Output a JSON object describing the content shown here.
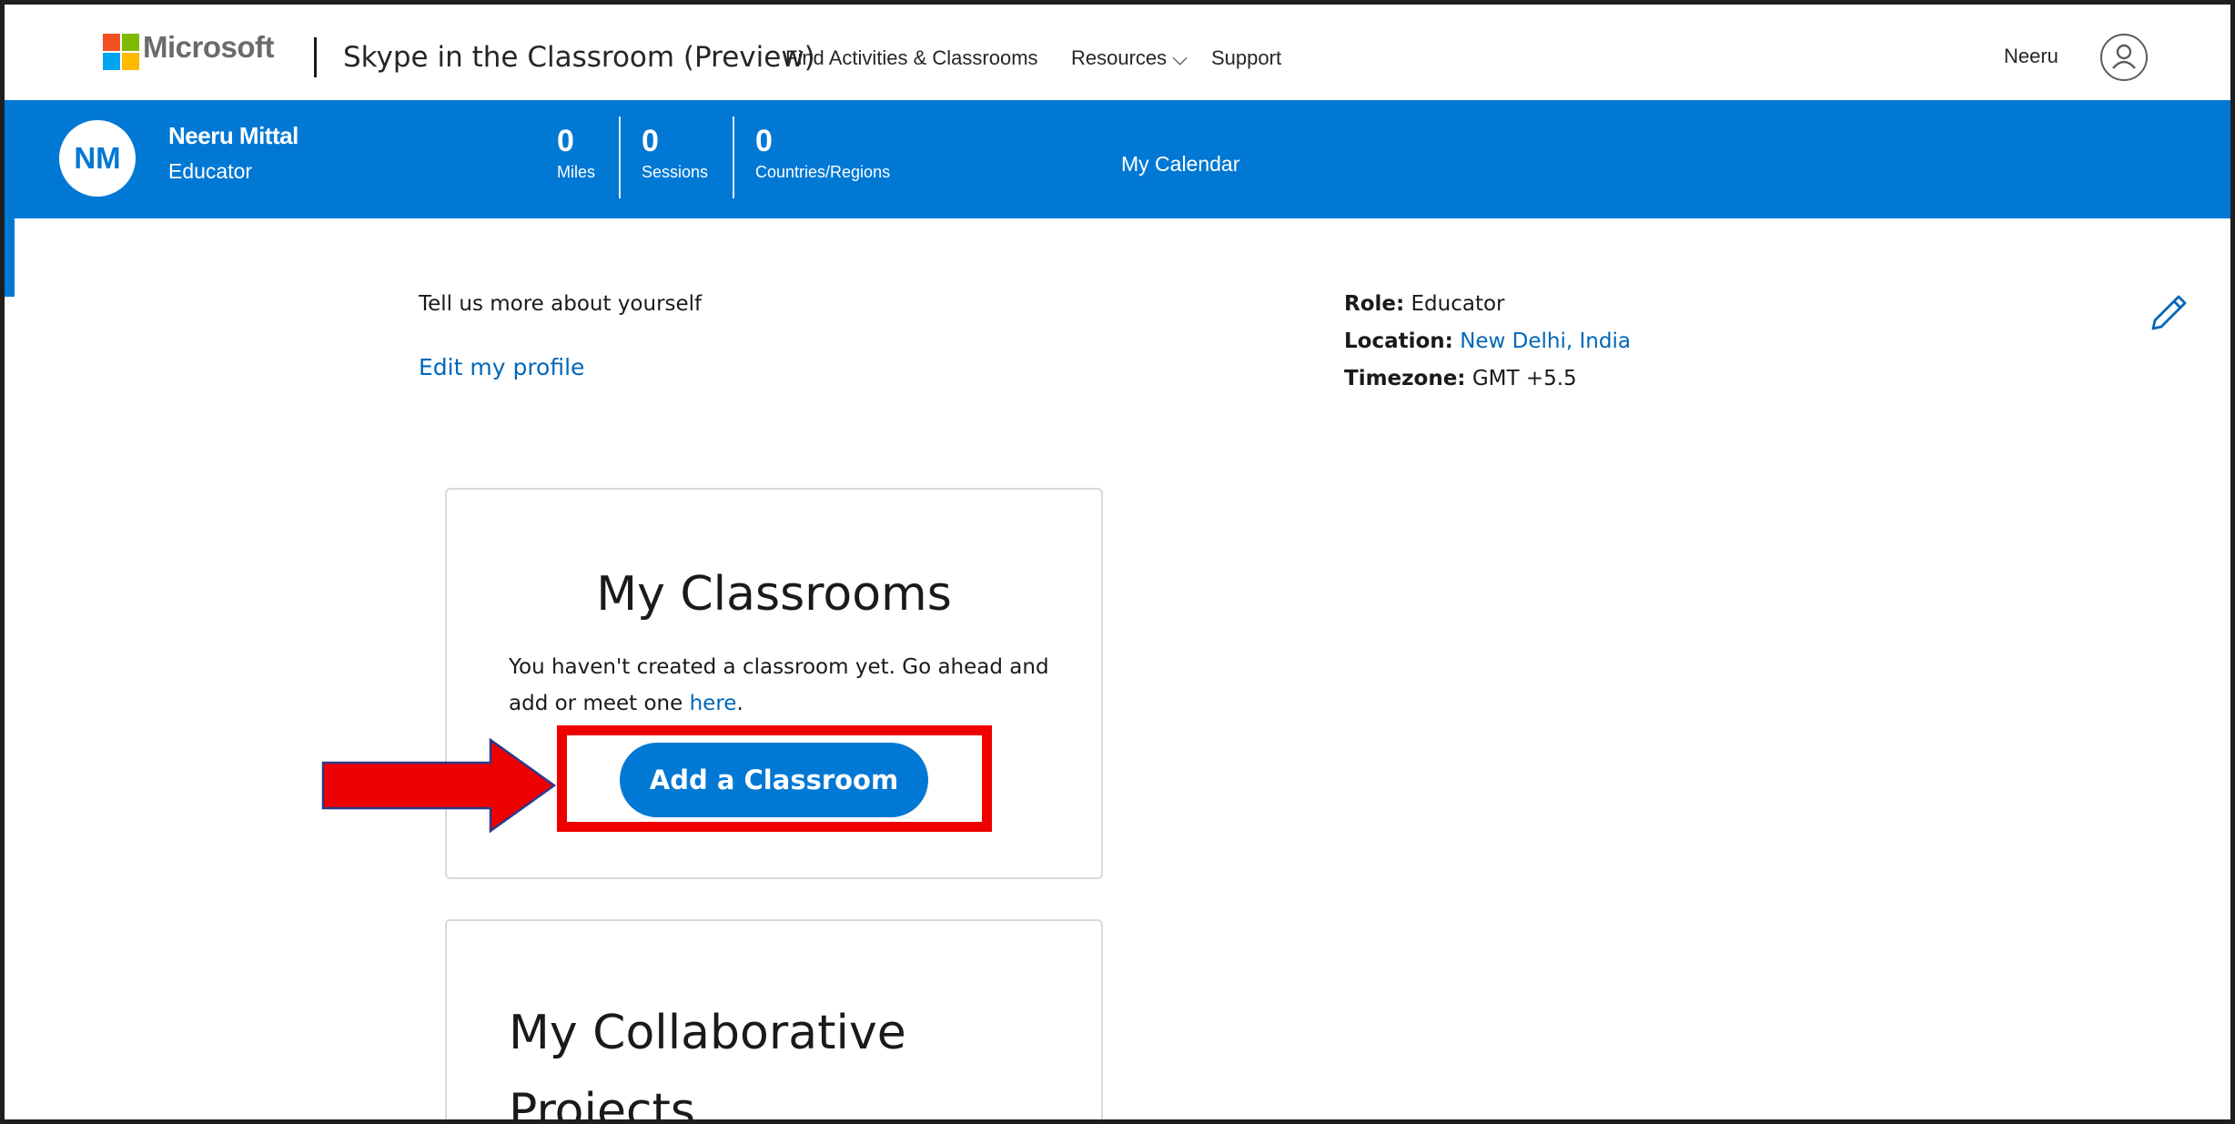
{
  "header": {
    "brand": "Microsoft",
    "site_title": "Skype in the Classroom (Preview)",
    "nav": {
      "find": "Find Activities & Classrooms",
      "resources": "Resources ⌵",
      "support": "Support"
    },
    "user_name": "Neeru",
    "user_icon": "person-icon",
    "logo_colors": [
      "#f25022",
      "#7fba00",
      "#00a4ef",
      "#ffb900"
    ]
  },
  "profile_band": {
    "initials": "NM",
    "name": "Neeru Mittal",
    "role": "Educator",
    "stats": [
      {
        "value": "0",
        "label": "Miles"
      },
      {
        "value": "0",
        "label": "Sessions"
      },
      {
        "value": "0",
        "label": "Countries/Regions"
      }
    ],
    "calendar_label": "My Calendar",
    "background": "#0078d4"
  },
  "about": {
    "prompt": "Tell us more about yourself",
    "edit_link": "Edit my profile"
  },
  "details": {
    "role_label": "Role:",
    "role_value": "Educator",
    "location_label": "Location:",
    "location_value": "New Delhi, India",
    "timezone_label": "Timezone:",
    "timezone_value": "GMT +5.5",
    "edit_icon": "pencil-icon"
  },
  "classrooms_card": {
    "title": "My Classrooms",
    "text_before": "You haven't created a classroom yet. Go ahead and add or meet one ",
    "link": "here",
    "text_after": ".",
    "button": "Add a Classroom"
  },
  "projects_card": {
    "title": "My Collaborative Projects"
  },
  "annotation": {
    "highlight_color": "#ee0000",
    "arrow_icon": "right-arrow-icon"
  }
}
